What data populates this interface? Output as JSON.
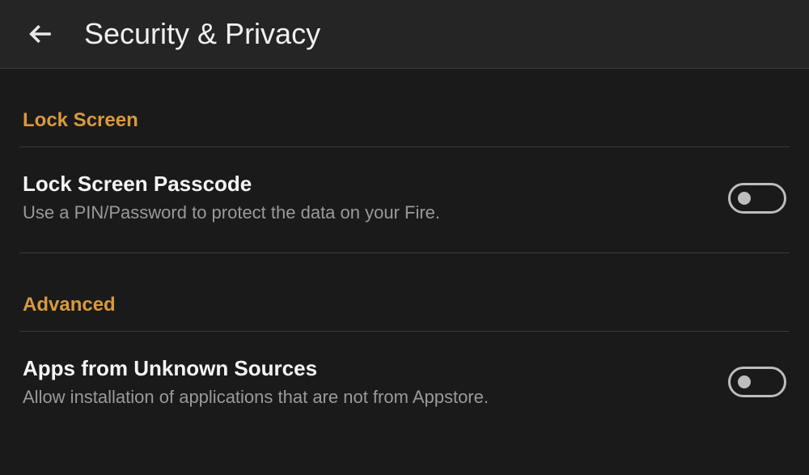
{
  "header": {
    "title": "Security & Privacy"
  },
  "sections": {
    "lockScreen": {
      "label": "Lock Screen",
      "item": {
        "title": "Lock Screen Passcode",
        "description": "Use a PIN/Password to protect the data on your Fire.",
        "enabled": false
      }
    },
    "advanced": {
      "label": "Advanced",
      "item": {
        "title": "Apps from Unknown Sources",
        "description": "Allow installation of applications that are not from Appstore.",
        "enabled": false
      }
    }
  }
}
